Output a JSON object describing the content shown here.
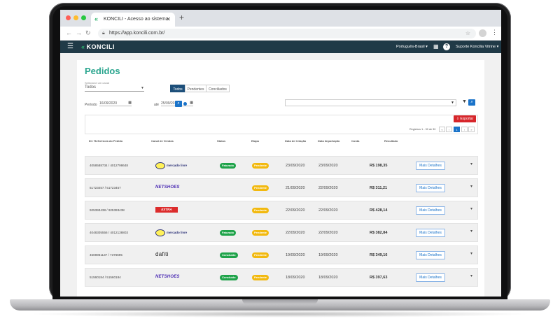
{
  "browser": {
    "tab_title": "KONCILI - Acesso ao sistema",
    "url": "https://app.koncili.com.br/",
    "dot_colors": [
      "#ff5f57",
      "#febc2e",
      "#28c840"
    ]
  },
  "appnav": {
    "brand": "KONCILI",
    "language": "Português-Brasil ▾",
    "user": "Suporte Koncilia Vitrine ▾"
  },
  "page": {
    "title": "Pedidos",
    "channel_label": "Selecione um canal",
    "channel_value": "Todos",
    "segments": [
      "Todos",
      "Pendentes",
      "Conciliados"
    ],
    "period_label": "Período",
    "date_from": "16/09/2020",
    "date_to_label": "até",
    "date_to": "25/09/2020",
    "export_label": "Exportar",
    "pagination_info": "Registros 1 - 30 de 30",
    "pagination": [
      "«",
      "‹",
      "1",
      "›",
      "»"
    ],
    "pagination_active": "1"
  },
  "table": {
    "headers": {
      "id": "ID / Referência do Pedido",
      "channel": "Canal de Vendas",
      "status": "Status",
      "stage": "Etapa",
      "created": "Data de Criação",
      "imported": "Data Importação",
      "account": "Conta",
      "result": "Resultado"
    },
    "more_label": "Mais Detalhes",
    "rows": [
      {
        "id": "4058588734 / 4012798648",
        "channel": "mercadolivre",
        "status": "Faturado",
        "status_color": "green",
        "stage": "Pendente",
        "created": "23/09/2020",
        "imported": "23/09/2020",
        "result": "R$ 198,35"
      },
      {
        "id": "51723457 / 51723457",
        "channel": "netshoes",
        "status": "",
        "status_color": "",
        "stage": "Pendente",
        "created": "21/09/2020",
        "imported": "22/09/2020",
        "result": "R$ 311,21"
      },
      {
        "id": "925393438 / 925393438",
        "channel": "extra",
        "status": "",
        "status_color": "",
        "stage": "Pendente",
        "created": "22/09/2020",
        "imported": "22/09/2020",
        "result": "R$ 428,14"
      },
      {
        "id": "4048305556 / 4012138803",
        "channel": "mercadolivre",
        "status": "Faturado",
        "status_color": "green",
        "stage": "Pendente",
        "created": "22/09/2020",
        "imported": "22/09/2020",
        "result": "R$ 382,84"
      },
      {
        "id": "4508961137 / 7376695",
        "channel": "dafiti",
        "status": "Concluído",
        "status_color": "green",
        "stage": "Pendente",
        "created": "19/09/2020",
        "imported": "19/09/2020",
        "result": "R$ 349,16"
      },
      {
        "id": "51560184 / 51560184",
        "channel": "netshoes",
        "status": "Concluído",
        "status_color": "green",
        "stage": "Pendente",
        "created": "18/09/2020",
        "imported": "18/09/2020",
        "result": "R$ 397,63"
      }
    ]
  },
  "logos": {
    "mercadolivre": "mercado livre",
    "netshoes": "NETSHOES",
    "extra": "EXTRA",
    "dafiti": "dafiti"
  },
  "colors": {
    "accent_teal": "#2aa58e",
    "nav": "#203a47",
    "primary": "#1a73c9",
    "danger": "#d7262b",
    "status_green": "#1fa34a",
    "stage_yellow": "#f2b90f"
  }
}
